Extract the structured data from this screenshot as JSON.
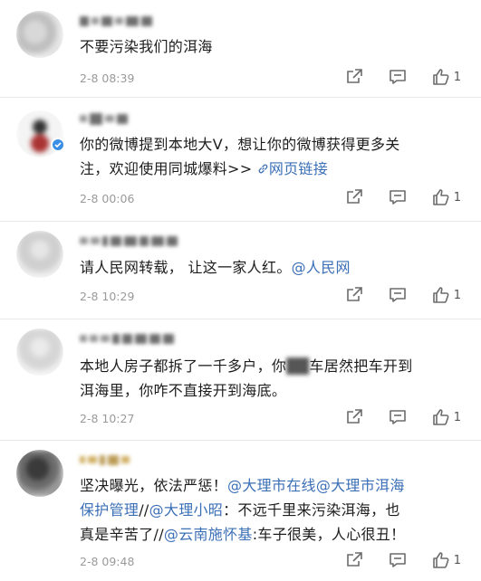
{
  "comments": [
    {
      "text": "不要污染我们的洱海",
      "time": "2-8 08:39",
      "likes": "1"
    },
    {
      "text_a": "你的微博提到本地大V，想让你的微博获得更多关",
      "text_b": "注，欢迎使用同城爆料>> ",
      "link_icon": "link-icon",
      "link": "网页链接",
      "time": "2-8 00:06",
      "likes": "1",
      "verified_badge": "verified-badge-icon"
    },
    {
      "text": "请人民网转载， 让这一家人红。",
      "mention": "@人民网",
      "time": "2-8 10:29",
      "likes": "1"
    },
    {
      "text_a1": "本地人房子都拆了一千多户，你",
      "text_a2": "车居然把车开到",
      "text_b": "洱海里，你咋不直接开到海底。",
      "time": "2-8 10:27",
      "likes": "1"
    },
    {
      "text_a": "坚决曝光，依法严惩！",
      "mention_1": "@大理市在线",
      "mention_2": "@大理市洱海",
      "mention_2b": "保护管理",
      "sep_1": "//",
      "mention_3": "@大理小昭",
      "text_b": "：不远千里来污染洱海，也",
      "text_c": "真是辛苦了//",
      "mention_4": "@云南施怀基",
      "text_d": ":车子很美，人心很丑！",
      "time": "2-8 09:48",
      "likes": "1"
    }
  ],
  "icons": {
    "repost": "repost-icon",
    "comment": "comment-icon",
    "like": "thumbs-up-icon"
  },
  "colors": {
    "mention": "#3b6fb6",
    "time": "#9a9a9a",
    "verified": "#3a8ee6"
  }
}
